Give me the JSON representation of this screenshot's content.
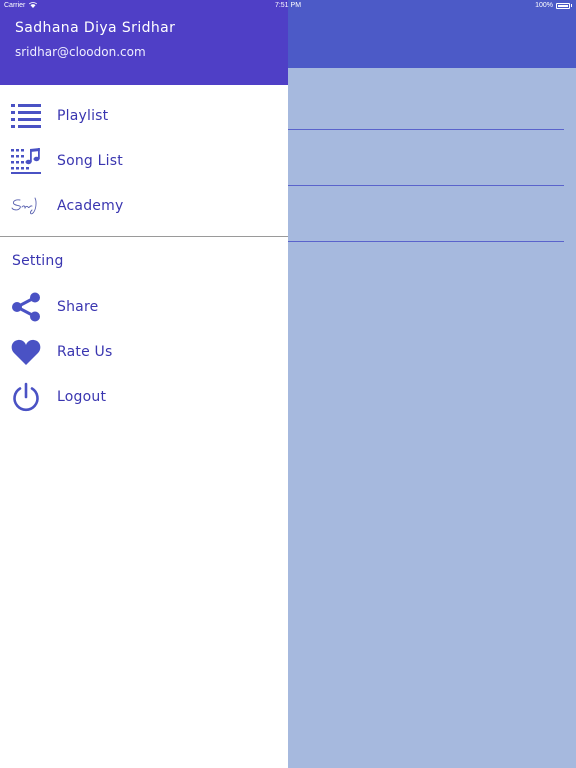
{
  "status_bar": {
    "carrier": "Carrier",
    "time": "7:51 PM",
    "battery": "100%"
  },
  "user": {
    "name": "Sadhana Diya Sridhar",
    "email": "sridhar@cloodon.com"
  },
  "menu": [
    {
      "label": "Playlist",
      "icon": "list-icon"
    },
    {
      "label": "Song List",
      "icon": "music-list-icon"
    },
    {
      "label": "Academy",
      "icon": "signature-logo-icon"
    }
  ],
  "settings": {
    "title": "Setting",
    "items": [
      {
        "label": "Share",
        "icon": "share-icon"
      },
      {
        "label": "Rate Us",
        "icon": "heart-icon"
      },
      {
        "label": "Logout",
        "icon": "power-icon"
      }
    ]
  },
  "colors": {
    "accent": "#4f3fc6",
    "icon": "#4a52c4",
    "text": "#3a36b0",
    "overlay": "#a6b9de"
  }
}
